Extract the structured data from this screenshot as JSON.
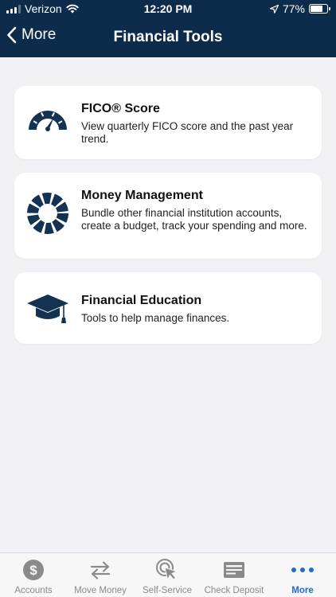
{
  "status_bar": {
    "carrier": "Verizon",
    "time": "12:20 PM",
    "battery_percent": "77%",
    "battery_level": 0.77
  },
  "nav": {
    "back_label": "More",
    "title": "Financial Tools"
  },
  "cards": [
    {
      "title": "FICO® Score",
      "description": "View quarterly FICO score and the past year trend.",
      "icon": "gauge-icon"
    },
    {
      "title": "Money Management",
      "description": "Bundle other financial institution accounts, create a budget, track your spending and more.",
      "icon": "donut-chart-icon"
    },
    {
      "title": "Financial Education",
      "description": "Tools to help manage finances.",
      "icon": "graduation-cap-icon"
    }
  ],
  "tabbar": {
    "items": [
      {
        "label": "Accounts",
        "icon": "dollar-circle-icon"
      },
      {
        "label": "Move Money",
        "icon": "transfer-arrows-icon"
      },
      {
        "label": "Self-Service",
        "icon": "pointer-click-icon"
      },
      {
        "label": "Check Deposit",
        "icon": "check-icon"
      },
      {
        "label": "More",
        "icon": "more-dots-icon"
      }
    ],
    "active": "More"
  },
  "colors": {
    "header_bg": "#0d2b4a",
    "icon_navy": "#143352",
    "tab_active": "#1e6bd6",
    "tab_inactive": "#8a8a8a",
    "page_bg": "#f0f0f5"
  }
}
